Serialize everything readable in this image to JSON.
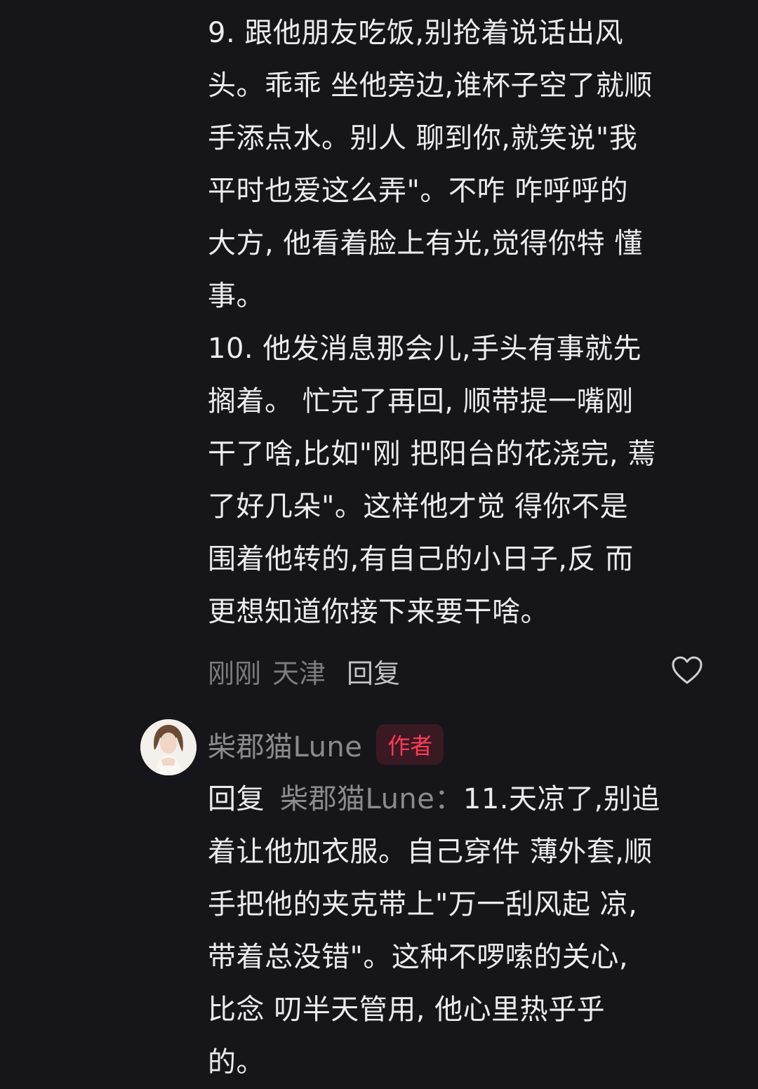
{
  "comment_1": {
    "lines": [
      "9. 跟他朋友吃饭,别抢着说话出风",
      "头。乖乖 坐他旁边,谁杯子空了就顺",
      "手添点水。别人 聊到你,就笑说\"我",
      "平时也爱这么弄\"。不咋 咋呼呼的",
      "大方, 他看着脸上有光,觉得你特 懂",
      "事。",
      "10. 他发消息那会儿,手头有事就先",
      "搁着。 忙完了再回, 顺带提一嘴刚",
      "干了啥,比如\"刚 把阳台的花浇完, 蔫",
      "了好几朵\"。这样他才觉 得你不是",
      "围着他转的,有自己的小日子,反 而",
      "更想知道你接下来要干啥。"
    ],
    "time": "刚刚",
    "location": "天津",
    "reply_label": "回复",
    "like_icon": "heart-outline-icon"
  },
  "comment_2": {
    "author": "柴郡猫Lune",
    "badge": "作者",
    "reply_prefix": "回复",
    "reply_target": "柴郡猫Lune：",
    "first_line_text": "11.天凉了,别追",
    "lines": [
      "着让他加衣服。自己穿件 薄外套,顺",
      "手把他的夹克带上\"万一刮风起 凉,",
      "带着总没错\"。这种不啰嗦的关心,",
      "比念 叨半天管用, 他心里热乎乎",
      "的。"
    ]
  },
  "colors": {
    "background": "#161519",
    "text": "#ecebef",
    "muted": "#7c7b82",
    "author_badge": "#ff3a5a"
  }
}
